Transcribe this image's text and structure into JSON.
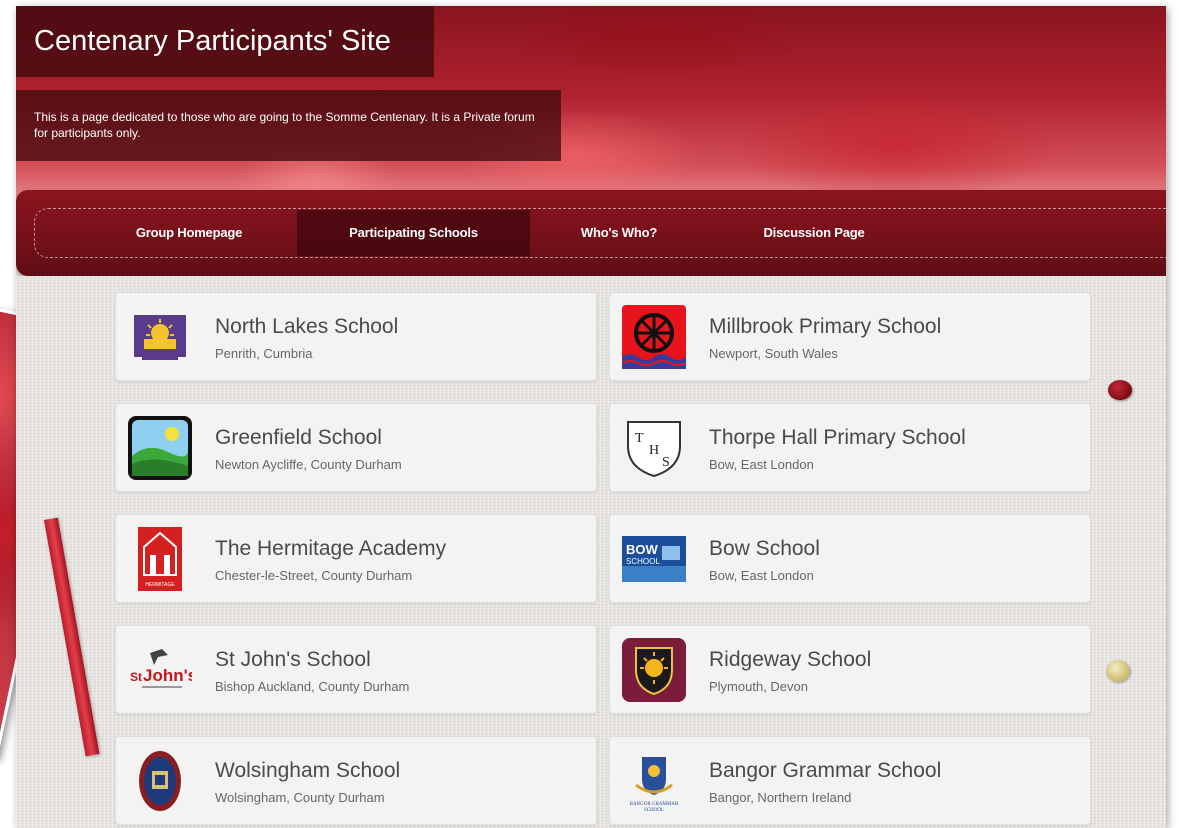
{
  "site": {
    "title": "Centenary Participants' Site",
    "description": "This is a page dedicated to those who are going to the Somme Centenary. It is a Private forum for participants only."
  },
  "nav": {
    "items": [
      {
        "label": "Group Homepage",
        "active": false
      },
      {
        "label": "Participating Schools",
        "active": true
      },
      {
        "label": "Who's Who?",
        "active": false
      },
      {
        "label": "Discussion Page",
        "active": false
      }
    ]
  },
  "schools": [
    {
      "name": "North Lakes School",
      "location": "Penrith, Cumbria",
      "logo": "north-lakes-logo"
    },
    {
      "name": "Millbrook Primary School",
      "location": "Newport, South Wales",
      "logo": "millbrook-wheel-logo"
    },
    {
      "name": "Greenfield School",
      "location": "Newton Aycliffe, County Durham",
      "logo": "greenfield-landscape-logo"
    },
    {
      "name": "Thorpe Hall Primary School",
      "location": "Bow, East London",
      "logo": "thorpe-hall-shield-logo",
      "logo_text": "THS"
    },
    {
      "name": "The Hermitage Academy",
      "location": "Chester-le-Street, County Durham",
      "logo": "hermitage-logo",
      "logo_text": "HERMITAGE"
    },
    {
      "name": "Bow School",
      "location": "Bow, East London",
      "logo": "bow-school-logo",
      "logo_text": "BOW SCHOOL"
    },
    {
      "name": "St John's School",
      "location": "Bishop Auckland, County Durham",
      "logo": "st-johns-logo",
      "logo_text": "StJohn's"
    },
    {
      "name": "Ridgeway School",
      "location": "Plymouth, Devon",
      "logo": "ridgeway-shield-logo"
    },
    {
      "name": "Wolsingham School",
      "location": "Wolsingham, County Durham",
      "logo": "wolsingham-crest-logo"
    },
    {
      "name": "Bangor Grammar School",
      "location": "Bangor, Northern Ireland",
      "logo": "bangor-crest-logo",
      "logo_text": "BANGOR GRAMMAR SCHOOL"
    }
  ],
  "colors": {
    "nav_bg": "#741019",
    "nav_active": "#3a060b",
    "header_box": "#460a10",
    "card_bg": "#f3f3f3",
    "school_name": "#4a4a4a"
  }
}
